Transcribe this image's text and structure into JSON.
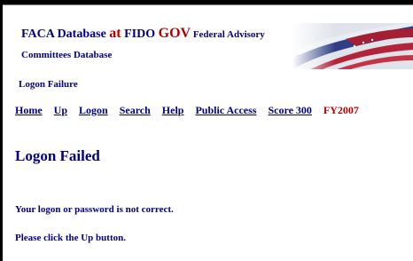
{
  "banner": {
    "title_part1": "FACA Database ",
    "title_at": "at",
    "title_part2": " FIDO ",
    "title_gov": "GOV",
    "title_part3": " Federal Advisory",
    "title_line2": "Committees Database",
    "image": "american-flag-banner"
  },
  "page": {
    "subtitle": "Logon Failure",
    "heading": "Logon Failed",
    "message_line1": "Your logon or password is not correct.",
    "message_line2": "Please click the Up button."
  },
  "nav": {
    "items": [
      "Home",
      "Up",
      "Logon",
      "Search",
      "Help",
      "Public Access",
      "Score 300"
    ],
    "fiscal_year": "FY2007"
  },
  "colors": {
    "link": "#000080",
    "accent_red": "#b20000",
    "frame": "#000000"
  }
}
